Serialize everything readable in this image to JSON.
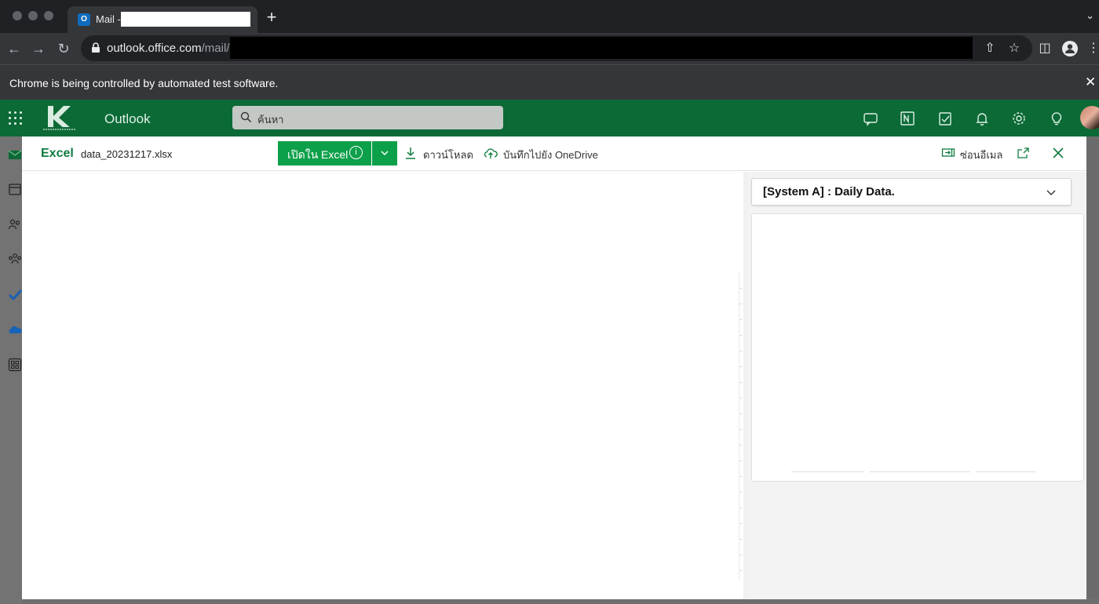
{
  "browser": {
    "tab_title": "Mail -",
    "tab_favicon": "outlook-icon",
    "url_host": "outlook.office.com",
    "url_path": "/mail/",
    "infobar_text": "Chrome is being controlled by automated test software.",
    "colors": {
      "frame": "#202124",
      "toolbar": "#35363a"
    }
  },
  "outlook": {
    "title": "Outlook",
    "search_placeholder": "ค้นหา",
    "header_icons": [
      "teams-chat-icon",
      "onenote-icon",
      "my-day-icon",
      "bell-icon",
      "gear-icon",
      "lightbulb-icon"
    ],
    "brand_color": "#0b6a36"
  },
  "viewer": {
    "app_name": "Excel",
    "file_name": "data_20231217.xlsx",
    "open_label": "เปิดใน Excel",
    "download_label": "ดาวน์โหลด",
    "save_onedrive_label": "บันทึกไปยัง OneDrive",
    "hide_email_label": "ซ่อนอีเมล",
    "sheet_selector": "[System A] : Daily Data.",
    "accent_color": "#107c41"
  }
}
